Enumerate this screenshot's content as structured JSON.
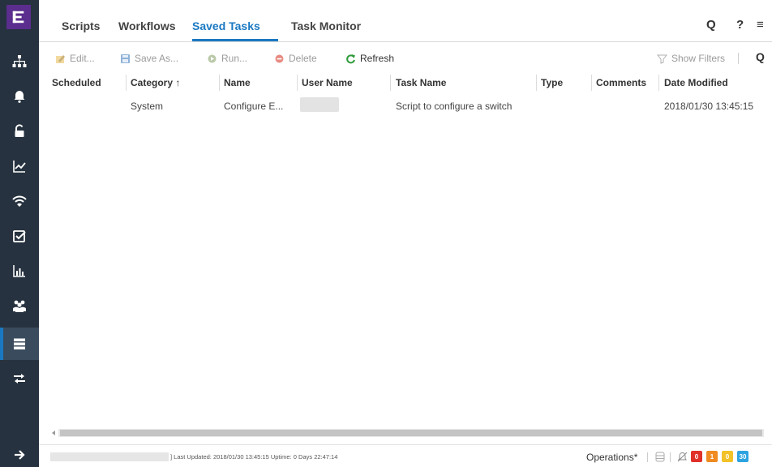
{
  "sidebar": {
    "logo": "E",
    "items": [
      {
        "icon": "network-icon"
      },
      {
        "icon": "alarm-bell-icon"
      },
      {
        "icon": "lock-icon"
      },
      {
        "icon": "analytics-line-icon"
      },
      {
        "icon": "wireless-icon"
      },
      {
        "icon": "tasks-check-icon"
      },
      {
        "icon": "reports-bar-icon"
      },
      {
        "icon": "users-icon"
      },
      {
        "icon": "tasks-list-icon"
      },
      {
        "icon": "administration-arrows-icon"
      },
      {
        "icon": "expand-arrow-icon"
      }
    ],
    "active_index": 8
  },
  "tabs": [
    {
      "label": "Scripts"
    },
    {
      "label": "Workflows"
    },
    {
      "label": "Saved Tasks"
    },
    {
      "label": "Task Monitor"
    }
  ],
  "top_icons": {
    "search": "Q",
    "help": "?",
    "menu": "≡"
  },
  "toolbar": {
    "edit": "Edit...",
    "save_as": "Save As...",
    "run": "Run...",
    "delete": "Delete",
    "refresh": "Refresh",
    "show_filters": "Show Filters",
    "search_glyph": "Q"
  },
  "table": {
    "columns": [
      "Scheduled",
      "Category ↑",
      "Name",
      "User Name",
      "Task Name",
      "Type",
      "Comments",
      "Date Modified"
    ],
    "rows": [
      {
        "scheduled": "",
        "category": "System",
        "name": "Configure E...",
        "user_name": "",
        "task_name": "Script to configure a switch",
        "type": "",
        "comments": "",
        "date_modified": "2018/01/30 13:45:15"
      }
    ]
  },
  "status_bar": {
    "text": "] Last Updated: 2018/01/30 13:45:15   Uptime: 0 Days 22:47:14",
    "operations": "Operations*",
    "badges": [
      {
        "value": "0",
        "color": "#e0302a"
      },
      {
        "value": "1",
        "color": "#f08a22"
      },
      {
        "value": "0",
        "color": "#f2c228"
      },
      {
        "value": "30",
        "color": "#2ea3e0"
      }
    ]
  },
  "colors": {
    "accent": "#1a78c2",
    "sidebar": "#26323f",
    "logo": "#5b2d8e",
    "refresh": "#2e9a3a",
    "delete": "#e85a4f"
  }
}
